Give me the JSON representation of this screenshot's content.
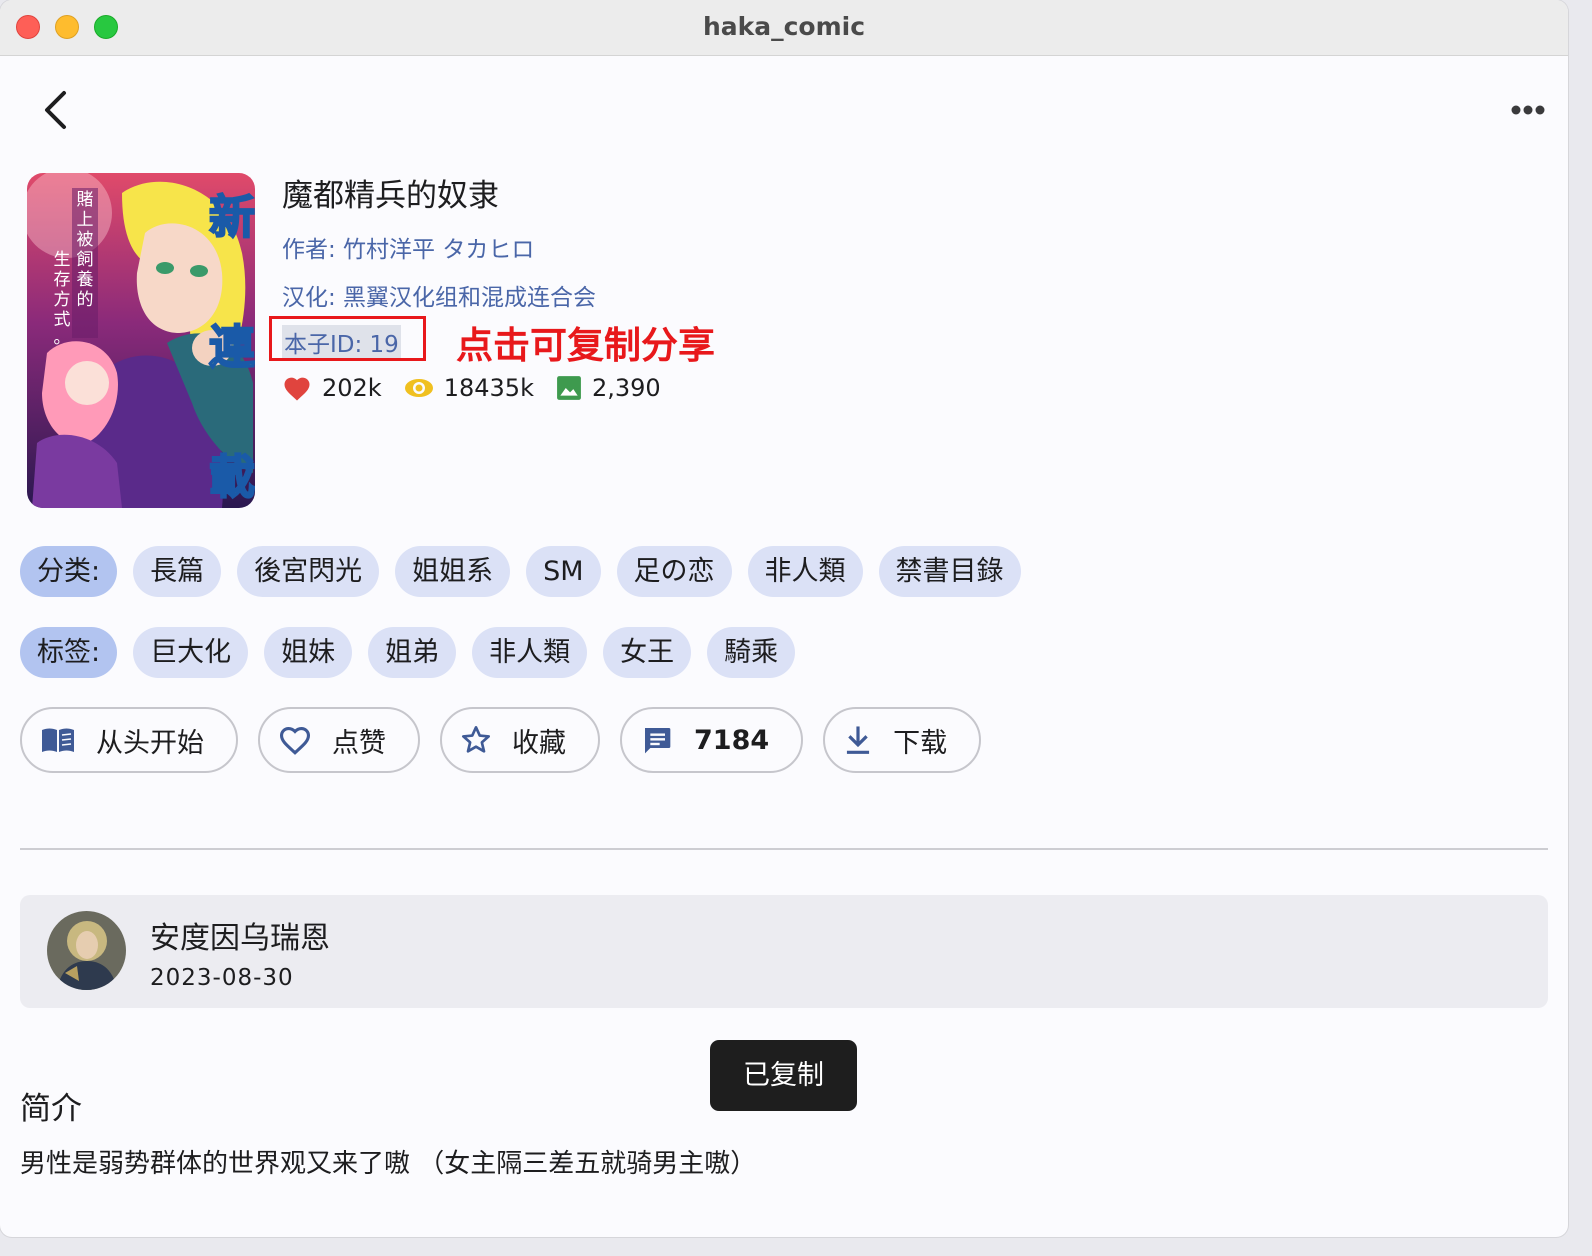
{
  "window": {
    "title": "haka_comic"
  },
  "comic": {
    "title": "魔都精兵的奴隶",
    "author": "作者: 竹村洋平  タカヒロ",
    "chinese_team": "汉化: 黑翼汉化组和混成连合会",
    "id_label": "本子ID: 19",
    "annotation": "点击可复制分享",
    "cover_text": {
      "left_vertical": "賭上被飼養的生存方式。",
      "right_vertical": [
        "新",
        "連",
        "載"
      ]
    }
  },
  "stats": {
    "likes": "202k",
    "views": "18435k",
    "pages": "2,390"
  },
  "categories": {
    "label": "分类:",
    "items": [
      "長篇",
      "後宮閃光",
      "姐姐系",
      "SM",
      "足の恋",
      "非人類",
      "禁書目錄"
    ]
  },
  "tags": {
    "label": "标签:",
    "items": [
      "巨大化",
      "姐妹",
      "姐弟",
      "非人類",
      "女王",
      "騎乘"
    ]
  },
  "actions": {
    "read_from_start": "从头开始",
    "like": "点赞",
    "favorite": "收藏",
    "comments": "7184",
    "download": "下载"
  },
  "uploader": {
    "name": "安度因乌瑞恩",
    "date": "2023-08-30"
  },
  "toast": "已复制",
  "intro": {
    "title": "简介",
    "text": "男性是弱势群体的世界观又来了嗷 （女主隔三差五就骑男主嗷）"
  },
  "colors": {
    "accent_link": "#4a66a8",
    "chip_bg": "#dbe1f6",
    "chip_label_bg": "#b2c4f0",
    "annotation_red": "#e8181b",
    "like_red": "#e0443e",
    "view_yellow": "#f0c020",
    "image_green": "#3e9a4e"
  }
}
